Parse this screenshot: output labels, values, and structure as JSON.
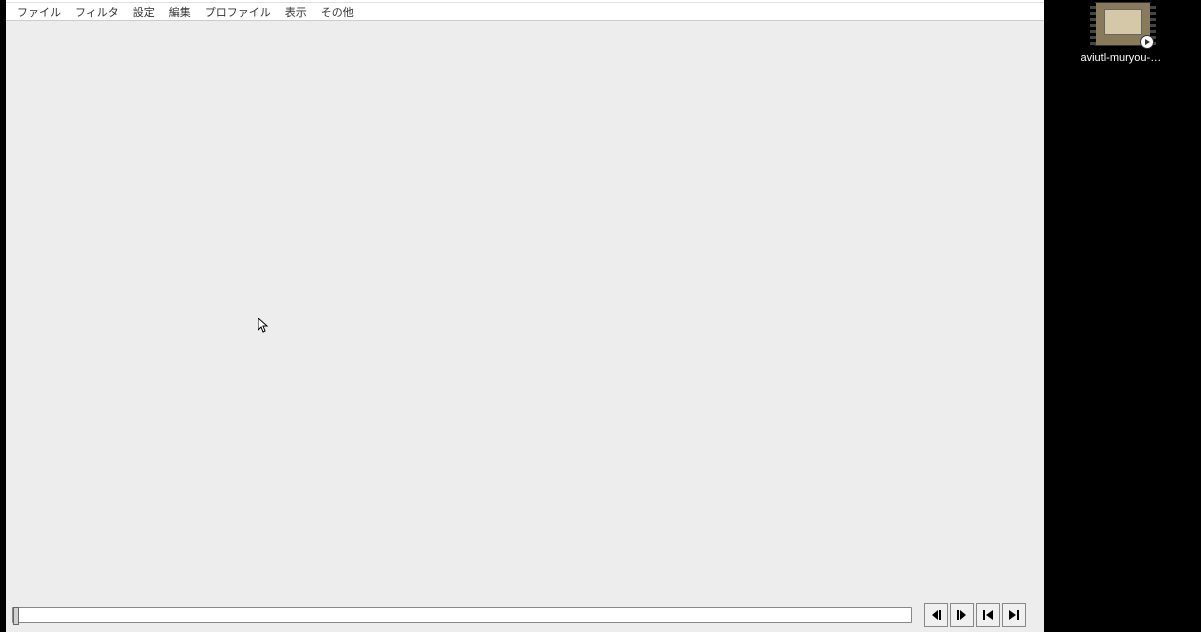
{
  "menu": {
    "items": [
      "ファイル",
      "フィルタ",
      "設定",
      "編集",
      "プロファイル",
      "表示",
      "その他"
    ]
  },
  "timeline": {
    "position": 0
  },
  "desktop": {
    "video_file": {
      "label": "aviutl-muryou-g..."
    }
  }
}
